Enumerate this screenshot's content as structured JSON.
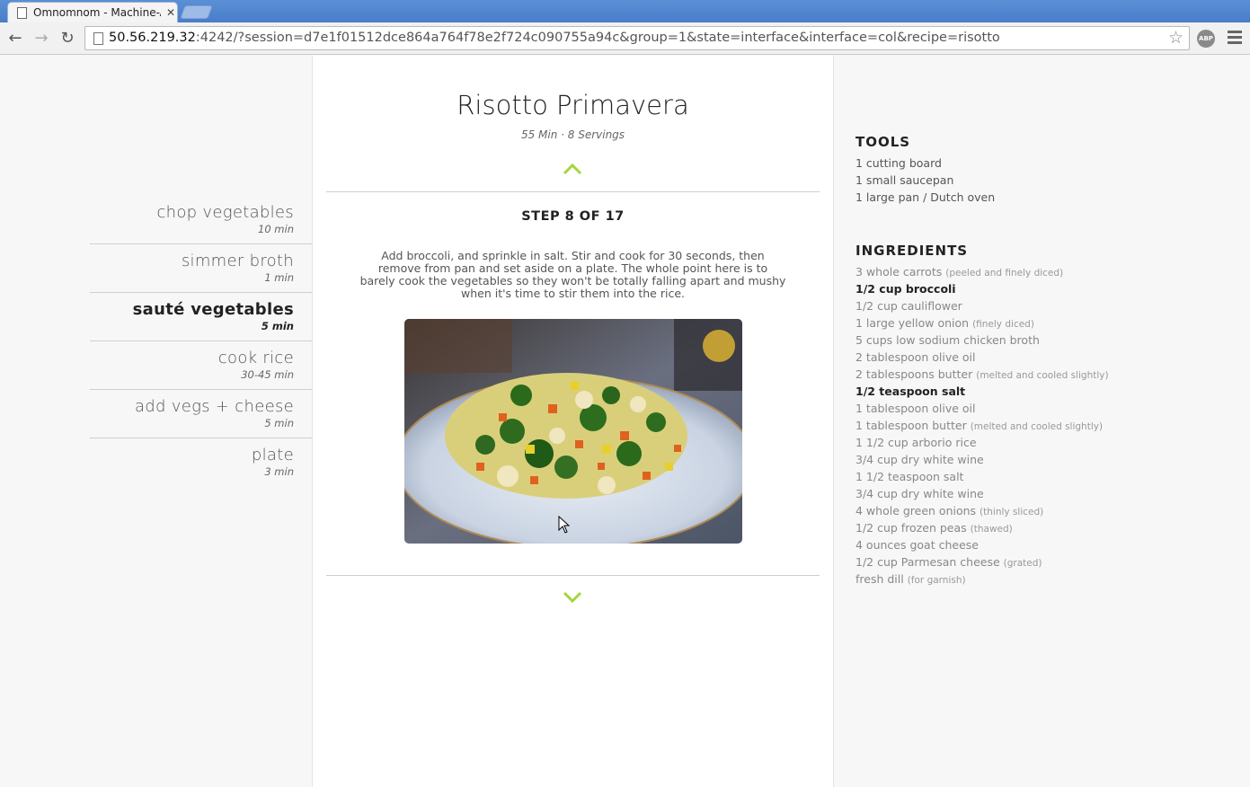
{
  "browser": {
    "tab_title": "Omnomnom - Machine-A",
    "url_host": "50.56.219.32",
    "url_rest": ":4242/?session=d7e1f01512dce864a764f78e2f724c090755a94c&group=1&state=interface&interface=col&recipe=risotto",
    "abp_label": "ABP"
  },
  "recipe": {
    "title": "Risotto Primavera",
    "meta": "55 Min · 8 Servings"
  },
  "steps": [
    {
      "name": "chop vegetables",
      "time": "10 min",
      "active": false
    },
    {
      "name": "simmer broth",
      "time": "1 min",
      "active": false
    },
    {
      "name": "sauté vegetables",
      "time": "5 min",
      "active": true
    },
    {
      "name": "cook rice",
      "time": "30-45 min",
      "active": false
    },
    {
      "name": "add vegs + cheese",
      "time": "5 min",
      "active": false
    },
    {
      "name": "plate",
      "time": "3 min",
      "active": false
    }
  ],
  "current_step": {
    "heading": "STEP 8 OF 17",
    "text": "Add broccoli, and sprinkle in salt. Stir and cook for 30 seconds, then remove from pan and set aside on a plate. The whole point here is to barely cook the vegetables so they won't be totally falling apart and mushy when it's time to stir them into the rice."
  },
  "tools": {
    "title": "TOOLS",
    "items": [
      "1 cutting board",
      "1 small saucepan",
      "1 large pan / Dutch oven"
    ]
  },
  "ingredients": {
    "title": "INGREDIENTS",
    "items": [
      {
        "text": "3 whole carrots",
        "note": "(peeled and finely diced)",
        "current": false
      },
      {
        "text": "1/2 cup broccoli",
        "note": "",
        "current": true
      },
      {
        "text": "1/2 cup cauliflower",
        "note": "",
        "current": false
      },
      {
        "text": "1 large yellow onion",
        "note": "(finely diced)",
        "current": false
      },
      {
        "text": "5 cups low sodium chicken broth",
        "note": "",
        "current": false
      },
      {
        "text": "2 tablespoon olive oil",
        "note": "",
        "current": false
      },
      {
        "text": "2 tablespoons butter",
        "note": "(melted and cooled slightly)",
        "current": false
      },
      {
        "text": "1/2 teaspoon salt",
        "note": "",
        "current": true
      },
      {
        "text": "1 tablespoon olive oil",
        "note": "",
        "current": false
      },
      {
        "text": "1 tablespoon butter",
        "note": "(melted and cooled slightly)",
        "current": false
      },
      {
        "text": "1 1/2 cup arborio rice",
        "note": "",
        "current": false
      },
      {
        "text": "3/4 cup dry white wine",
        "note": "",
        "current": false
      },
      {
        "text": "1 1/2 teaspoon salt",
        "note": "",
        "current": false
      },
      {
        "text": "3/4 cup dry white wine",
        "note": "",
        "current": false
      },
      {
        "text": "4 whole green onions",
        "note": "(thinly sliced)",
        "current": false
      },
      {
        "text": "1/2 cup frozen peas",
        "note": "(thawed)",
        "current": false
      },
      {
        "text": "4 ounces goat cheese",
        "note": "",
        "current": false
      },
      {
        "text": "1/2 cup Parmesan cheese",
        "note": "(grated)",
        "current": false
      },
      {
        "text": "fresh dill",
        "note": "(for garnish)",
        "current": false
      }
    ]
  },
  "colors": {
    "accent": "#a5d63a",
    "text_dark": "#222222",
    "text_muted": "#888888"
  },
  "icons": {
    "back": "back-arrow-icon",
    "forward": "forward-arrow-icon",
    "reload": "reload-icon",
    "bookmark": "star-icon",
    "menu": "hamburger-menu-icon",
    "prev_step": "chevron-up-icon",
    "next_step": "chevron-down-icon"
  }
}
